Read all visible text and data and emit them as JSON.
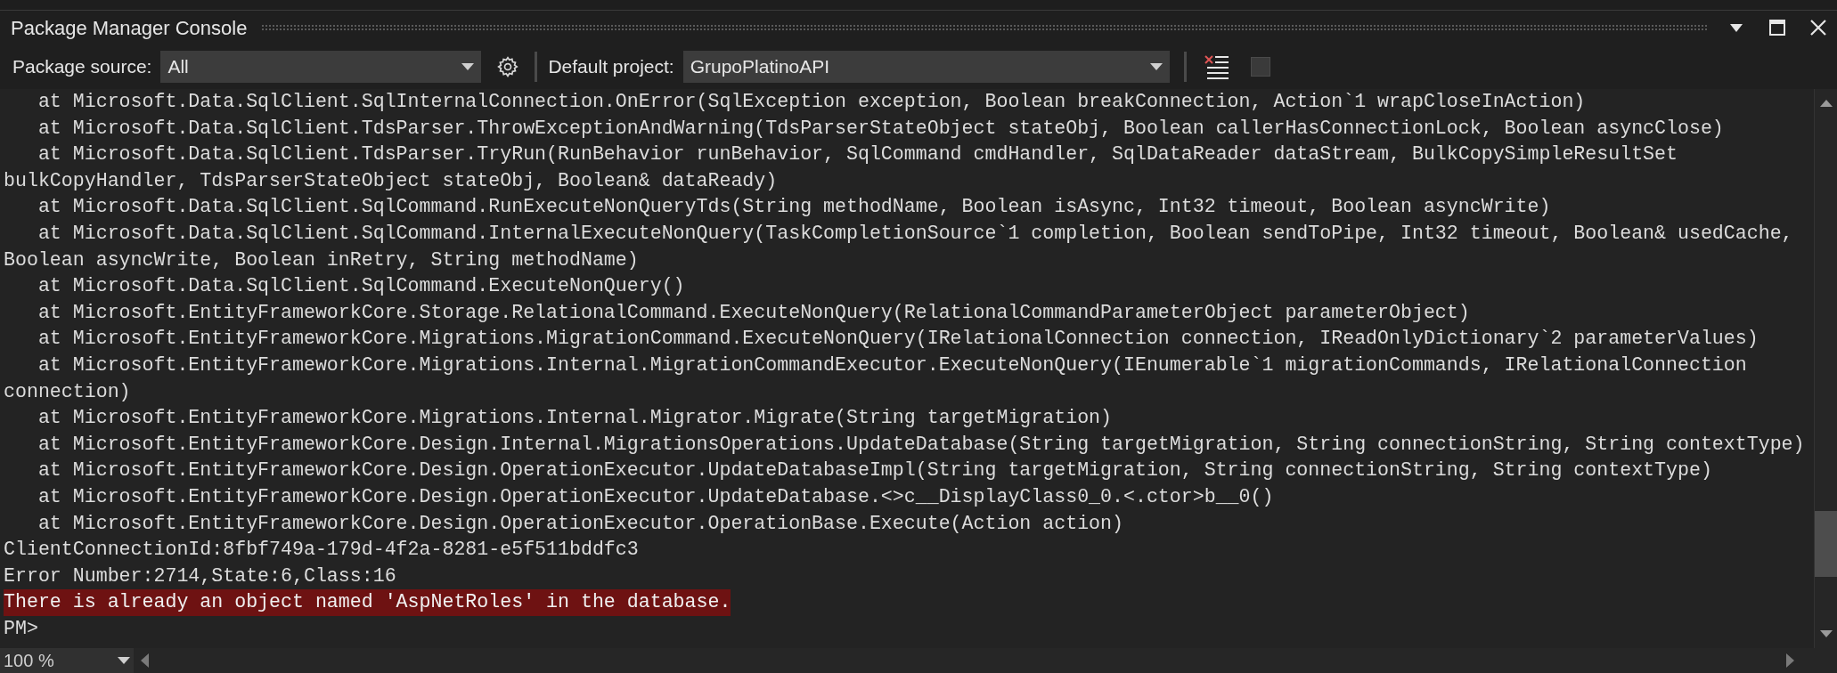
{
  "window": {
    "title": "Package Manager Console"
  },
  "toolbar": {
    "package_source": {
      "label": "Package source:",
      "value": "All"
    },
    "default_project": {
      "label": "Default project:",
      "value": "GrupoPlatinoAPI"
    }
  },
  "console": {
    "lines": [
      {
        "kind": "output",
        "text": "   at Microsoft.Data.SqlClient.SqlInternalConnection.OnError(SqlException exception, Boolean breakConnection, Action`1 wrapCloseInAction)"
      },
      {
        "kind": "output",
        "text": "   at Microsoft.Data.SqlClient.TdsParser.ThrowExceptionAndWarning(TdsParserStateObject stateObj, Boolean callerHasConnectionLock, Boolean asyncClose)"
      },
      {
        "kind": "output",
        "text": "   at Microsoft.Data.SqlClient.TdsParser.TryRun(RunBehavior runBehavior, SqlCommand cmdHandler, SqlDataReader dataStream, BulkCopySimpleResultSet"
      },
      {
        "kind": "output",
        "text": "bulkCopyHandler, TdsParserStateObject stateObj, Boolean& dataReady)"
      },
      {
        "kind": "output",
        "text": "   at Microsoft.Data.SqlClient.SqlCommand.RunExecuteNonQueryTds(String methodName, Boolean isAsync, Int32 timeout, Boolean asyncWrite)"
      },
      {
        "kind": "output",
        "text": "   at Microsoft.Data.SqlClient.SqlCommand.InternalExecuteNonQuery(TaskCompletionSource`1 completion, Boolean sendToPipe, Int32 timeout, Boolean& usedCache,"
      },
      {
        "kind": "output",
        "text": "Boolean asyncWrite, Boolean inRetry, String methodName)"
      },
      {
        "kind": "output",
        "text": "   at Microsoft.Data.SqlClient.SqlCommand.ExecuteNonQuery()"
      },
      {
        "kind": "output",
        "text": "   at Microsoft.EntityFrameworkCore.Storage.RelationalCommand.ExecuteNonQuery(RelationalCommandParameterObject parameterObject)"
      },
      {
        "kind": "output",
        "text": "   at Microsoft.EntityFrameworkCore.Migrations.MigrationCommand.ExecuteNonQuery(IRelationalConnection connection, IReadOnlyDictionary`2 parameterValues)"
      },
      {
        "kind": "output",
        "text": "   at Microsoft.EntityFrameworkCore.Migrations.Internal.MigrationCommandExecutor.ExecuteNonQuery(IEnumerable`1 migrationCommands, IRelationalConnection"
      },
      {
        "kind": "output",
        "text": "connection)"
      },
      {
        "kind": "output",
        "text": "   at Microsoft.EntityFrameworkCore.Migrations.Internal.Migrator.Migrate(String targetMigration)"
      },
      {
        "kind": "output",
        "text": "   at Microsoft.EntityFrameworkCore.Design.Internal.MigrationsOperations.UpdateDatabase(String targetMigration, String connectionString, String contextType)"
      },
      {
        "kind": "output",
        "text": "   at Microsoft.EntityFrameworkCore.Design.OperationExecutor.UpdateDatabaseImpl(String targetMigration, String connectionString, String contextType)"
      },
      {
        "kind": "output",
        "text": "   at Microsoft.EntityFrameworkCore.Design.OperationExecutor.UpdateDatabase.<>c__DisplayClass0_0.<.ctor>b__0()"
      },
      {
        "kind": "output",
        "text": "   at Microsoft.EntityFrameworkCore.Design.OperationExecutor.OperationBase.Execute(Action action)"
      },
      {
        "kind": "output",
        "text": "ClientConnectionId:8fbf749a-179d-4f2a-8281-e5f511bddfc3"
      },
      {
        "kind": "output",
        "text": "Error Number:2714,State:6,Class:16"
      },
      {
        "kind": "error",
        "text": "There is already an object named 'AspNetRoles' in the database."
      },
      {
        "kind": "prompt",
        "text": "PM>"
      }
    ]
  },
  "status_bar": {
    "zoom": "100 %"
  }
}
